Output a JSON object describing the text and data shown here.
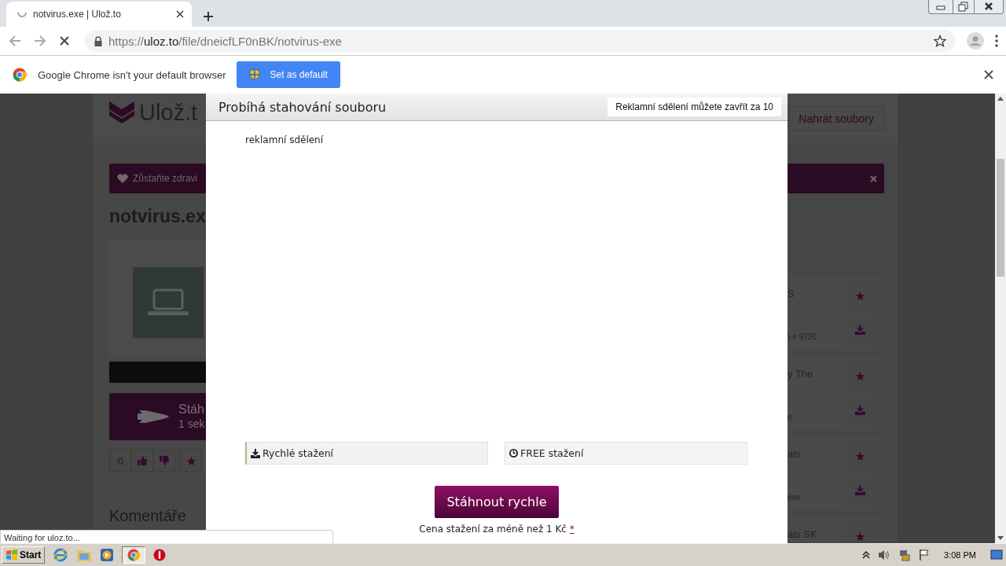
{
  "browser": {
    "tab": {
      "title": "notvirus.exe | Ulož.to",
      "loading": true
    },
    "address": {
      "scheme": "https://",
      "host": "uloz.to",
      "path": "/file/dneicfLF0nBK/notvirus-exe"
    },
    "infobar": {
      "message": "Google Chrome isn't your default browser",
      "button": "Set as default"
    },
    "status": "Waiting for uloz.to..."
  },
  "page": {
    "logo": "Ulož.t",
    "upload_button": "Nahrát soubory",
    "banner": "Zůstaňte zdravi",
    "file_title": "notvirus.ex",
    "download": {
      "title": "Stáh",
      "subtitle": "1 sek"
    },
    "rating": "0",
    "comments_heading": "Komentáře",
    "related": [
      {
        "lines": [
          "S",
          ") × 9720"
        ]
      },
      {
        "lines": [
          "y The",
          "e"
        ]
      },
      {
        "lines": [
          "als",
          "exe"
        ]
      },
      {
        "lines": [
          "als SK"
        ]
      }
    ]
  },
  "modal": {
    "title": "Probíhá stahování souboru",
    "countdown": "Reklamní sdělení můžete zavřít za 10",
    "ad_label": "reklamní sdělení",
    "tabs": [
      {
        "label": "Rychlé stažení",
        "selected": true,
        "kind": "download"
      },
      {
        "label": "FREE stažení",
        "selected": false,
        "kind": "clock"
      }
    ],
    "button": "Stáhnout rychle",
    "price_note": "Cena stažení za méně než 1 Kč",
    "price_link": "*"
  },
  "taskbar": {
    "start": "Start",
    "clock": "3:08 PM"
  }
}
